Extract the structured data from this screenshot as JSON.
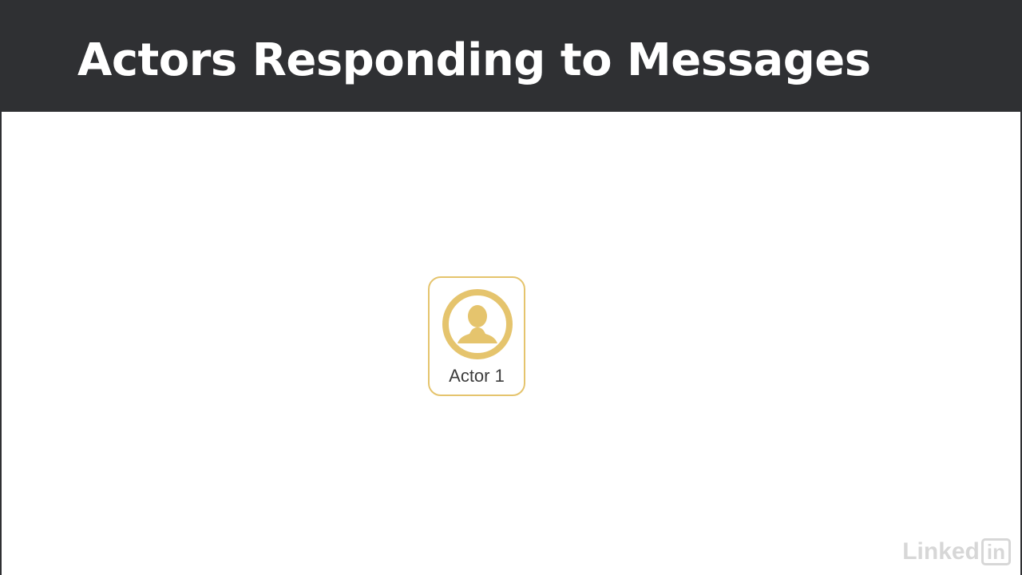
{
  "slide": {
    "title": "Actors Responding to Messages"
  },
  "diagram": {
    "actors": [
      {
        "label": "Actor 1",
        "icon": "person-icon",
        "color": "#e5c46d"
      }
    ]
  },
  "watermark": {
    "brand_text": "Linked",
    "brand_box": "in"
  },
  "colors": {
    "header_bg": "#2f3033",
    "accent": "#e5c46d",
    "text": "#3c3c3c"
  }
}
